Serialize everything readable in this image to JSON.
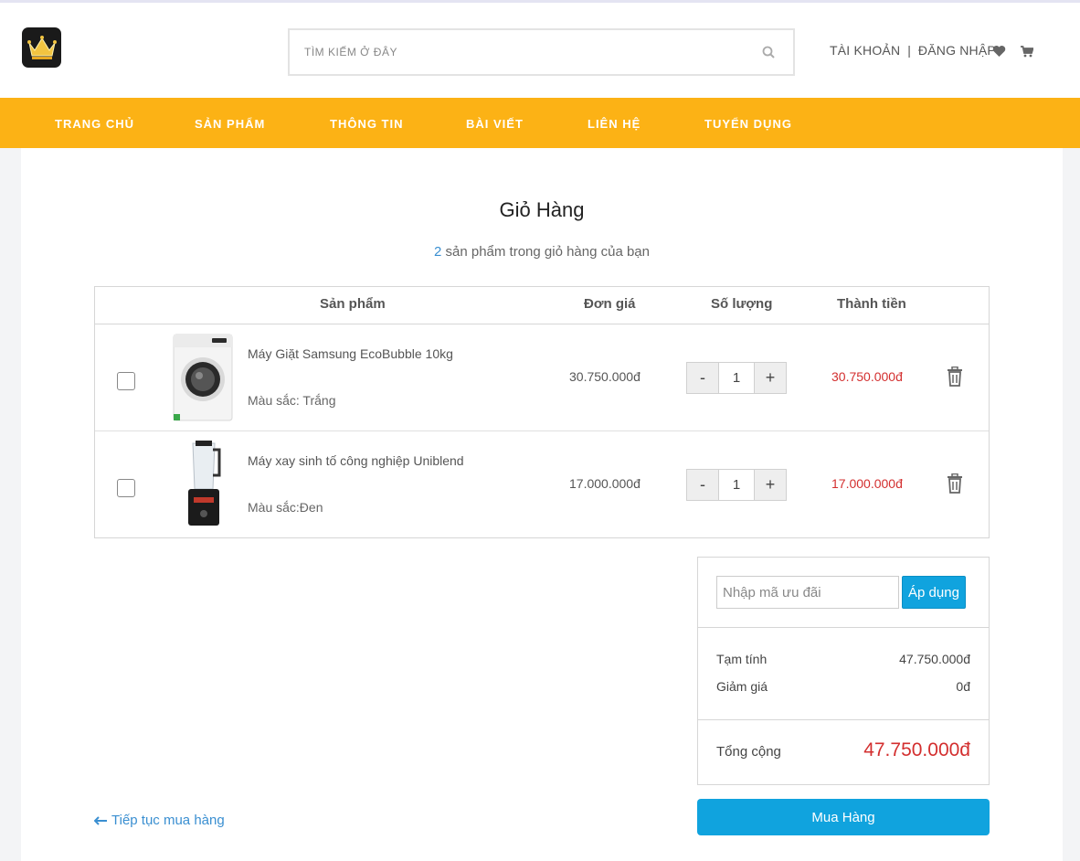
{
  "header": {
    "logo_icon": "crown-icon",
    "search": {
      "placeholder": "TÌM KIẾM Ở ĐÂY",
      "value": ""
    },
    "account_label": "TÀI KHOẢN",
    "separator": "|",
    "login_label": "ĐĂNG NHẬP",
    "icons": [
      "heart-icon",
      "cart-icon"
    ]
  },
  "nav": {
    "items": [
      {
        "label": "TRANG CHỦ"
      },
      {
        "label": "SẢN PHẨM"
      },
      {
        "label": "THÔNG TIN"
      },
      {
        "label": "BÀI VIẾT"
      },
      {
        "label": "LIÊN HỆ"
      },
      {
        "label": "TUYỂN DỤNG"
      }
    ]
  },
  "cart": {
    "title": "Giỏ Hàng",
    "count": "2",
    "count_text": " sản phẩm trong giỏ hàng của bạn",
    "columns": {
      "product": "Sản phẩm",
      "unit_price": "Đơn giá",
      "quantity": "Số lượng",
      "line_total": "Thành tiền"
    },
    "items": [
      {
        "name": "Máy Giặt Samsung EcoBubble 10kg",
        "color": "Màu sắc: Trắng",
        "price": "30.750.000đ",
        "quantity": "1",
        "total": "30.750.000đ",
        "checked": false
      },
      {
        "name": "Máy xay sinh tố công nghiệp Uniblend",
        "color": "Màu sắc:Đen",
        "price": "17.000.000đ",
        "quantity": "1",
        "total": "17.000.000đ",
        "checked": false
      }
    ],
    "minus_label": "-",
    "plus_label": "+"
  },
  "summary": {
    "coupon_placeholder": "Nhập mã ưu đãi",
    "apply_label": "Áp dụng",
    "subtotal_label": "Tạm tính",
    "subtotal_value": "47.750.000đ",
    "discount_label": "Giảm giá",
    "discount_value": "0đ",
    "total_label": "Tổng cộng",
    "total_value": "47.750.000đ",
    "buy_label": "Mua Hàng"
  },
  "continue_label": "Tiếp tục mua hàng",
  "colors": {
    "nav_bg": "#fcb215",
    "accent_blue": "#10a3de",
    "price_red": "#d32f2f",
    "link_blue": "#3a8fd1"
  }
}
